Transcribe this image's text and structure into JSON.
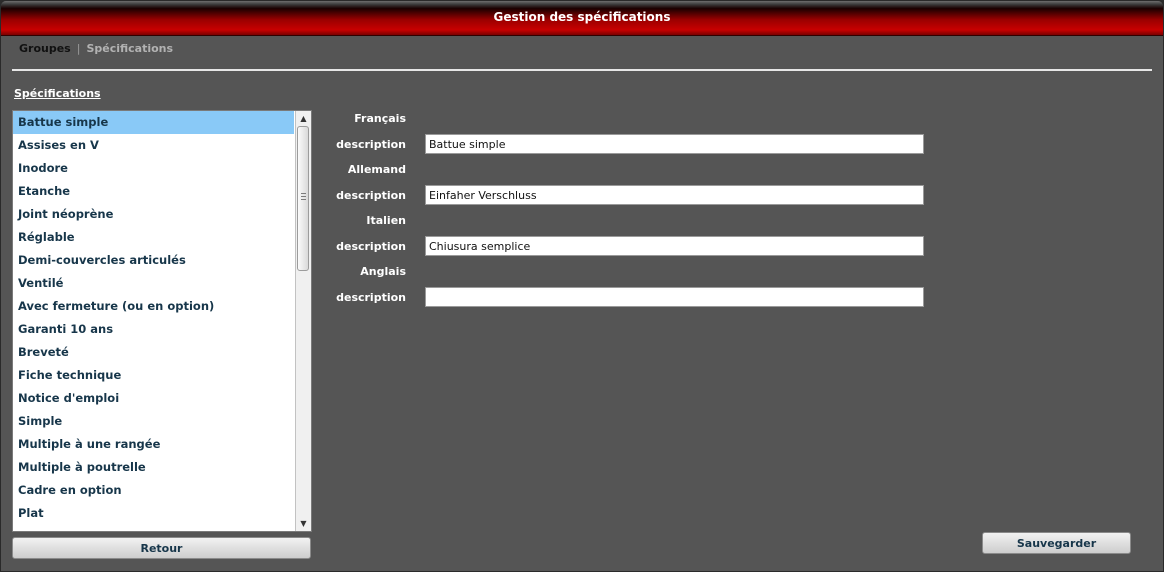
{
  "window": {
    "title": "Gestion des spécifications"
  },
  "tabs": {
    "active": "Groupes",
    "separator": "|",
    "inactive": "Spécifications"
  },
  "list": {
    "title": "Spécifications",
    "items": [
      "Battue simple",
      "Assises en V",
      "Inodore",
      "Etanche",
      "Joint néoprène",
      "Réglable",
      "Demi-couvercles articulés",
      "Ventilé",
      "Avec fermeture (ou en option)",
      "Garanti 10 ans",
      "Breveté",
      "Fiche technique",
      "Notice d'emploi",
      "Simple",
      "Multiple à une rangée",
      "Multiple à poutrelle",
      "Cadre en option",
      "Plat"
    ],
    "selected_index": 0
  },
  "form": {
    "francais": {
      "label": "Français",
      "desc_label": "description",
      "value": "Battue simple"
    },
    "allemand": {
      "label": "Allemand",
      "desc_label": "description",
      "value": "Einfaher Verschluss"
    },
    "italien": {
      "label": "Italien",
      "desc_label": "description",
      "value": "Chiusura semplice"
    },
    "anglais": {
      "label": "Anglais",
      "desc_label": "description",
      "value": ""
    }
  },
  "buttons": {
    "retour": "Retour",
    "save": "Sauvegarder"
  },
  "icons": {
    "scroll_up": "scroll-up-arrow-icon",
    "scroll_down": "scroll-down-arrow-icon"
  },
  "colors": {
    "title_bar": "#c80000",
    "selection": "#89c9f7",
    "background": "#555555"
  }
}
